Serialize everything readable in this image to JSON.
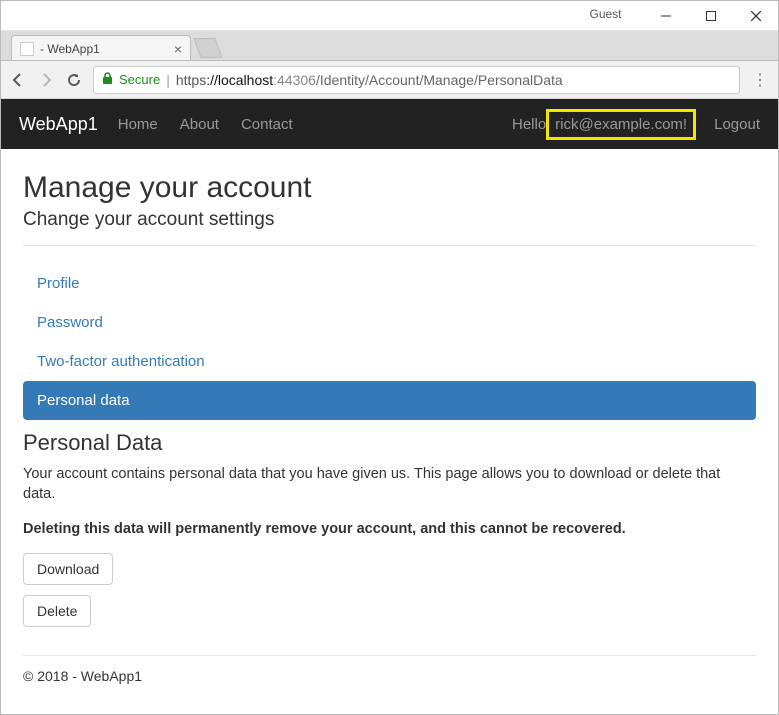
{
  "window": {
    "guest_label": "Guest"
  },
  "tab": {
    "title": " - WebApp1"
  },
  "address": {
    "secure": "Secure",
    "scheme": "https",
    "host": "://localhost",
    "port": ":44306",
    "path": "/Identity/Account/Manage/PersonalData"
  },
  "nav": {
    "brand": "WebApp1",
    "links": [
      "Home",
      "About",
      "Contact"
    ],
    "hello_prefix": "Hello ",
    "hello_user": "rick@example.com!",
    "logout": "Logout"
  },
  "page": {
    "title": "Manage your account",
    "subtitle": "Change your account settings",
    "menu": {
      "profile": "Profile",
      "password": "Password",
      "twofactor": "Two-factor authentication",
      "personaldata": "Personal data"
    },
    "section_title": "Personal Data",
    "desc": "Your account contains personal data that you have given us. This page allows you to download or delete that data.",
    "warn": "Deleting this data will permanently remove your account, and this cannot be recovered.",
    "download": "Download",
    "delete": "Delete"
  },
  "footer": {
    "text": "© 2018 - WebApp1"
  }
}
